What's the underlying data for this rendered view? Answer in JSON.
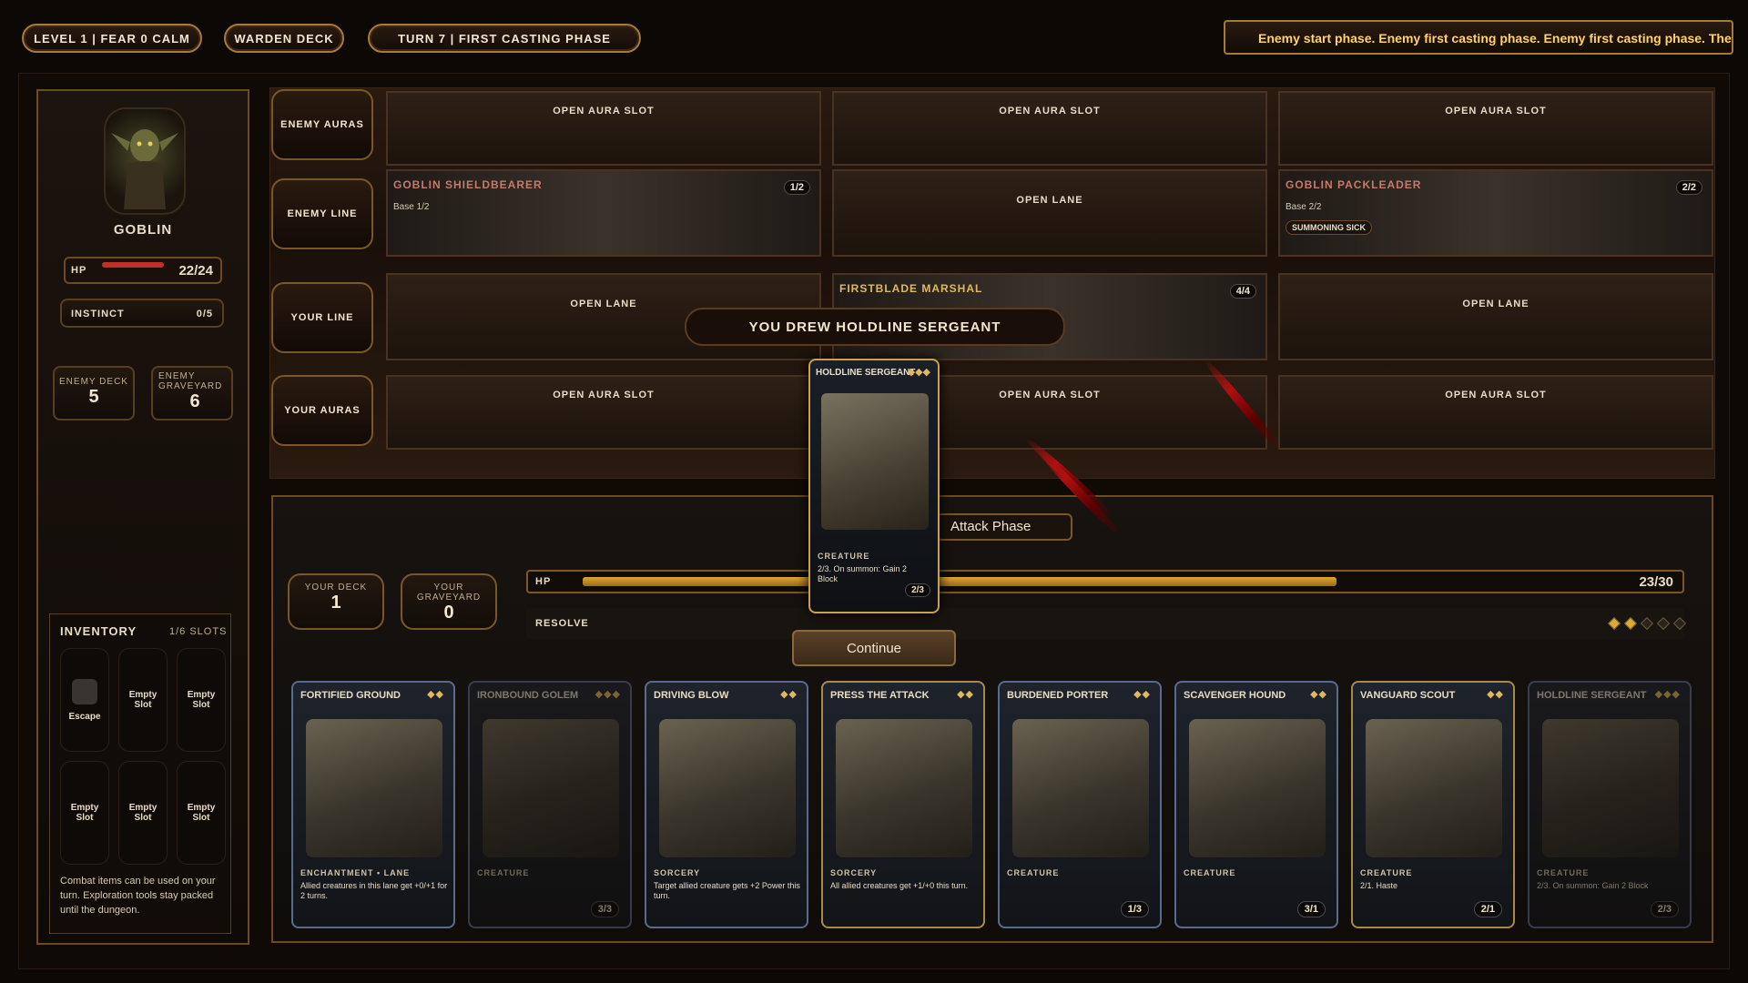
{
  "topbar": {
    "level_fear": "LEVEL 1 | FEAR 0 CALM",
    "deck_name": "WARDEN DECK",
    "turn": "TURN 7 | FIRST CASTING PHASE",
    "ticker": "Enemy start phase. Enemy first casting phase. Enemy first casting phase. The monst"
  },
  "enemy": {
    "name": "GOBLIN",
    "hp_label": "HP",
    "hp_value": "22/24",
    "hp_fraction": 0.917,
    "instinct_label": "INSTINCT",
    "instinct_value": "0/5",
    "deck_label": "ENEMY DECK",
    "deck_count": "5",
    "graveyard_label": "ENEMY GRAVEYARD",
    "graveyard_count": "6"
  },
  "inventory": {
    "title": "INVENTORY",
    "slots_label": "1/6 SLOTS",
    "slots": [
      "Escape",
      "Empty Slot",
      "Empty Slot",
      "Empty Slot",
      "Empty Slot",
      "Empty Slot"
    ],
    "note": "Combat items can be used on your turn. Exploration tools stay packed until the dungeon."
  },
  "board": {
    "row_labels": [
      "ENEMY AURAS",
      "ENEMY LINE",
      "YOUR LINE",
      "YOUR AURAS"
    ],
    "enemy_auras": [
      "OPEN AURA SLOT",
      "OPEN AURA SLOT",
      "OPEN AURA SLOT"
    ],
    "enemy_line": [
      {
        "name": "GOBLIN SHIELDBEARER",
        "base": "Base 1/2",
        "stat": "1/2"
      },
      {
        "open": "OPEN LANE"
      },
      {
        "name": "GOBLIN PACKLEADER",
        "base": "Base 2/2",
        "stat": "2/2",
        "badge": "SUMMONING SICK"
      }
    ],
    "your_line": [
      {
        "open": "OPEN LANE"
      },
      {
        "name": "FIRSTBLADE MARSHAL",
        "stat": "4/4"
      },
      {
        "open": "OPEN LANE"
      }
    ],
    "your_auras": [
      "OPEN AURA SLOT",
      "OPEN AURA SLOT",
      "OPEN AURA SLOT"
    ],
    "banner": "YOU DREW HOLDLINE SERGEANT"
  },
  "drawn_card": {
    "name": "HOLDLINE SERGEANT",
    "gems": "◆◆◆",
    "type": "CREATURE",
    "text": "2/3. On summon: Gain 2 Block",
    "stat": "2/3"
  },
  "player": {
    "deck_label": "YOUR DECK",
    "deck_count": "1",
    "graveyard_label": "YOUR GRAVEYARD",
    "graveyard_count": "0",
    "hp_label": "HP",
    "hp_value": "23/30",
    "hp_fraction": 0.767,
    "resolve_label": "RESOLVE",
    "resolve_filled": 2,
    "resolve_total": 5,
    "phase_button": "Attack Phase",
    "continue_button": "Continue"
  },
  "hand": [
    {
      "name": "FORTIFIED GROUND",
      "gems": "◆◆",
      "type": "ENCHANTMENT • LANE",
      "text": "Allied creatures in this lane get +0/+1 for 2 turns.",
      "stat": "",
      "dim": false
    },
    {
      "name": "IRONBOUND GOLEM",
      "gems": "◆◆◆",
      "type": "CREATURE",
      "text": "",
      "stat": "3/3",
      "dim": true
    },
    {
      "name": "DRIVING BLOW",
      "gems": "◆◆",
      "type": "SORCERY",
      "text": "Target allied creature gets +2 Power this turn.",
      "stat": "",
      "dim": false
    },
    {
      "name": "PRESS THE ATTACK",
      "gems": "◆◆",
      "type": "SORCERY",
      "text": "All allied creatures get +1/+0 this turn.",
      "stat": "",
      "dim": false
    },
    {
      "name": "BURDENED PORTER",
      "gems": "◆◆",
      "type": "CREATURE",
      "text": "",
      "stat": "1/3",
      "dim": false
    },
    {
      "name": "SCAVENGER HOUND",
      "gems": "◆◆",
      "type": "CREATURE",
      "text": "",
      "stat": "3/1",
      "dim": false
    },
    {
      "name": "VANGUARD SCOUT",
      "gems": "◆◆",
      "type": "CREATURE",
      "text": "2/1. Haste",
      "stat": "2/1",
      "dim": false
    },
    {
      "name": "HOLDLINE SERGEANT",
      "gems": "◆◆◆",
      "type": "CREATURE",
      "text": "2/3. On summon: Gain 2 Block",
      "stat": "2/3",
      "dim": true
    }
  ],
  "colors": {
    "gold": "#a67a3a",
    "hp_red": "#c0302a",
    "hp_gold": "#e0a830",
    "ticker_text": "#ffd36a"
  }
}
